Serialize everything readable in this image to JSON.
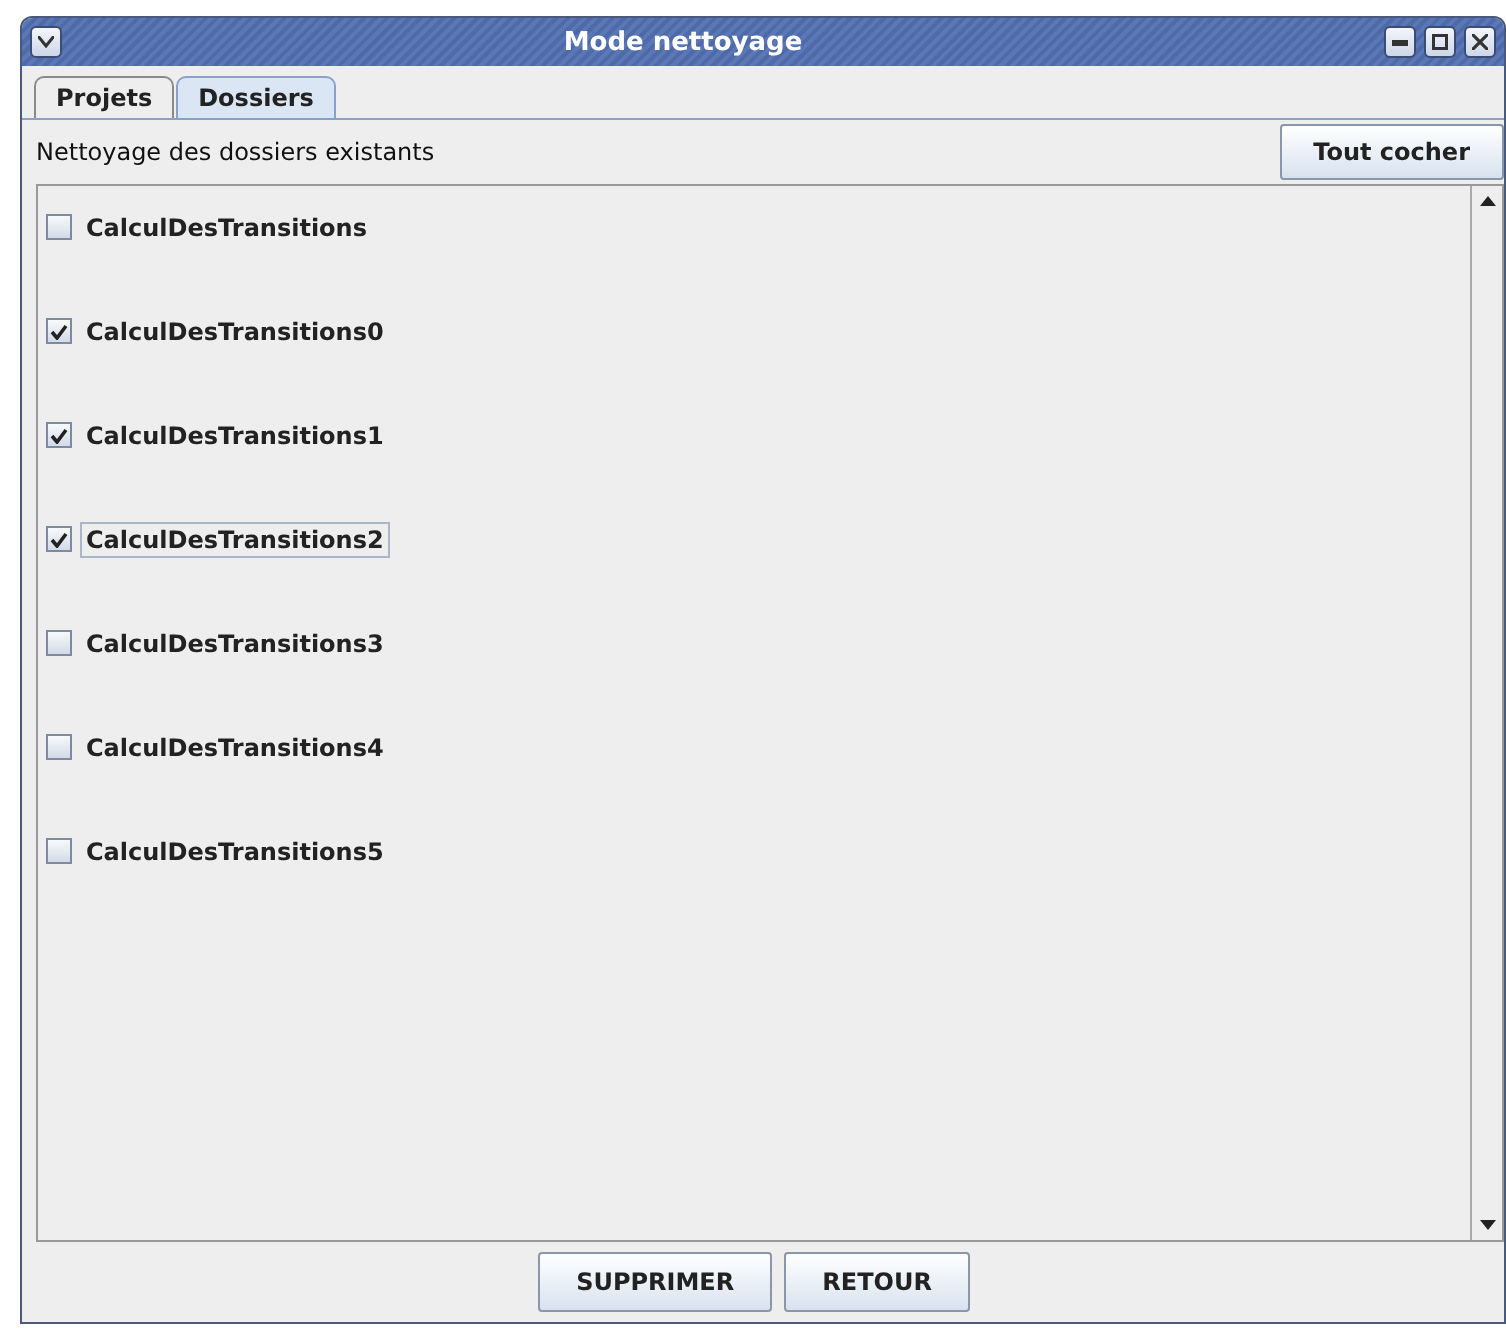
{
  "window": {
    "title": "Mode nettoyage"
  },
  "tabs": [
    {
      "label": "Projets",
      "selected": false
    },
    {
      "label": "Dossiers",
      "selected": true
    }
  ],
  "header": {
    "label": "Nettoyage des dossiers existants",
    "button": "Tout cocher"
  },
  "folders": [
    {
      "label": "CalculDesTransitions",
      "checked": false,
      "focused": false
    },
    {
      "label": "CalculDesTransitions0",
      "checked": true,
      "focused": false
    },
    {
      "label": "CalculDesTransitions1",
      "checked": true,
      "focused": false
    },
    {
      "label": "CalculDesTransitions2",
      "checked": true,
      "focused": true
    },
    {
      "label": "CalculDesTransitions3",
      "checked": false,
      "focused": false
    },
    {
      "label": "CalculDesTransitions4",
      "checked": false,
      "focused": false
    },
    {
      "label": "CalculDesTransitions5",
      "checked": false,
      "focused": false
    }
  ],
  "buttons": [
    "SUPPRIMER",
    "RETOUR"
  ]
}
